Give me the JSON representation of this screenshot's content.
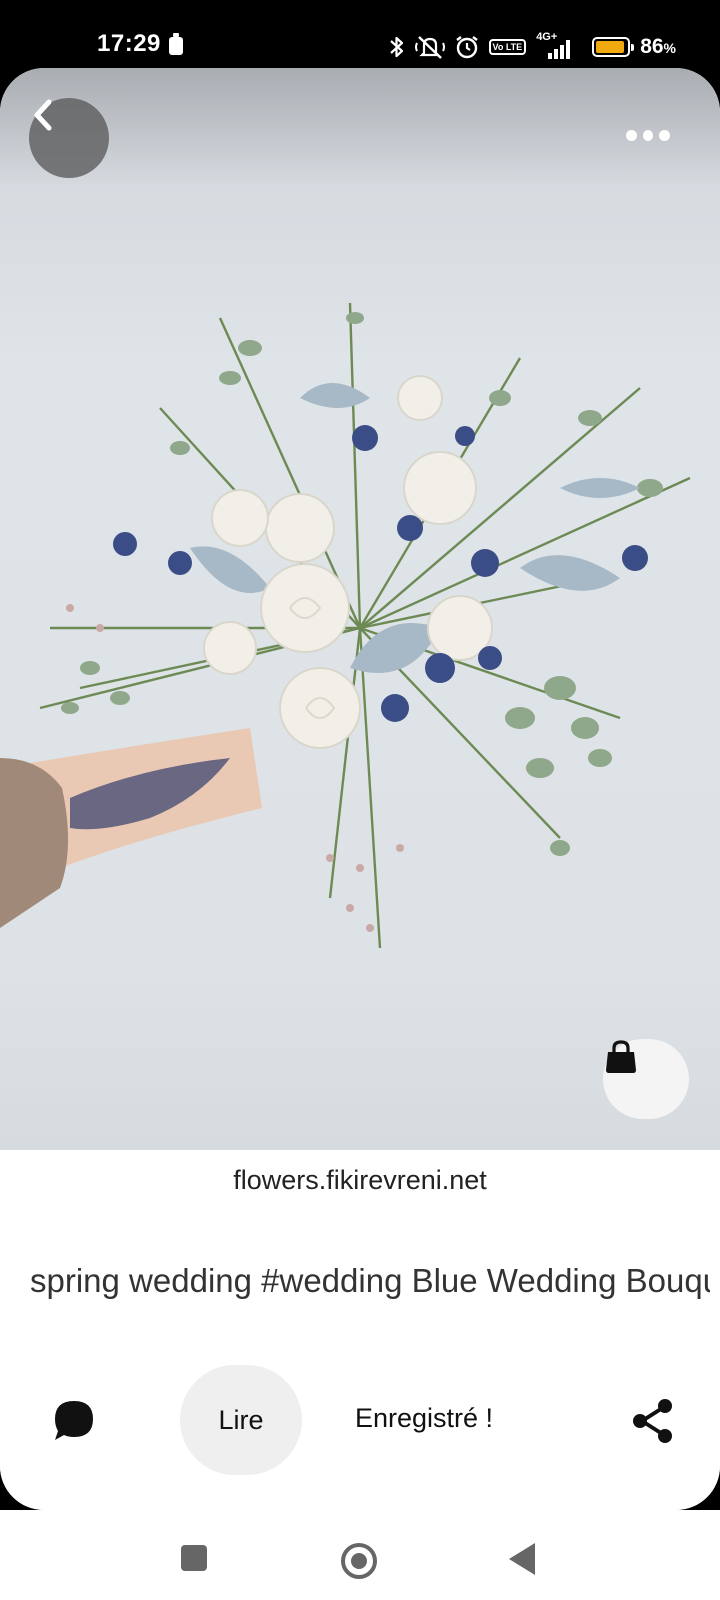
{
  "status_bar": {
    "time": "17:29",
    "battery_percent": "86",
    "battery_unit": "%",
    "network": "4G+",
    "volte": "Vo LTE",
    "icons": [
      "battery-saver-icon",
      "bluetooth-icon",
      "mute-icon",
      "alarm-icon",
      "volte-icon",
      "signal-icon",
      "battery-icon"
    ],
    "battery_color": "#F0A90E"
  },
  "pin": {
    "domain": "flowers.fikirevreni.net",
    "title": "spring wedding #wedding Blue Wedding Bouquet // winter weddi… – Flowers",
    "icons": [
      "back-icon",
      "more-icon",
      "shopping-bag-icon"
    ]
  },
  "actions": {
    "read_label": "Lire",
    "saved_label": "Enregistré !",
    "icons": [
      "comment-icon",
      "share-icon"
    ]
  },
  "nav_bar": {
    "icons": [
      "recents-icon",
      "home-icon",
      "back-icon"
    ]
  }
}
